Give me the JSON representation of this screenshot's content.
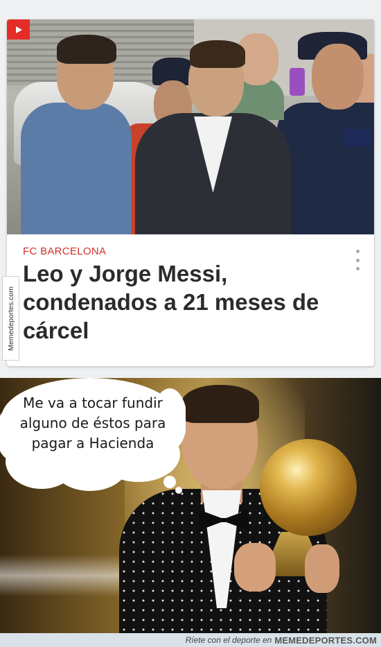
{
  "card": {
    "category": "FC BARCELONA",
    "headline": "Leo y Jorge Messi, condenados a 21 meses de cárcel",
    "video_badge_icon": "play-icon",
    "menu_icon": "more-vert-icon",
    "accent_color": "#d3302b"
  },
  "watermark": {
    "side_text": "Memedeportes.com"
  },
  "meme": {
    "bubble_lines": [
      "Me va a tocar fundir",
      "alguno de éstos para",
      "pagar a Hacienda"
    ]
  },
  "footer": {
    "tagline": "Ríete con el deporte en",
    "brand": "MEMEDEPORTES.COM"
  }
}
